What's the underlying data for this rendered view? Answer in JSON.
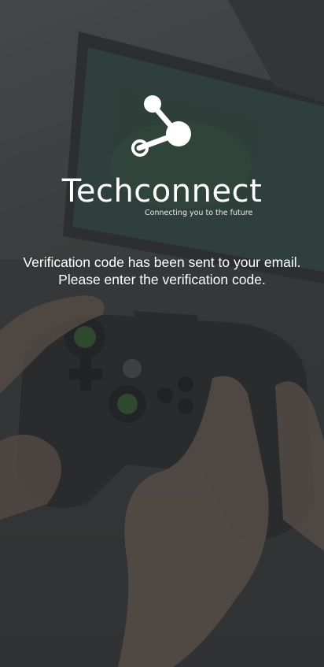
{
  "app": {
    "brand_name": "Techconnect",
    "tagline": "Connecting you to the future",
    "logo_icon": "share-nodes-icon"
  },
  "verification": {
    "message": "Verification code has been sent to your email. Please enter the verification code."
  },
  "colors": {
    "text": "#ffffff",
    "overlay": "#2f3132"
  }
}
